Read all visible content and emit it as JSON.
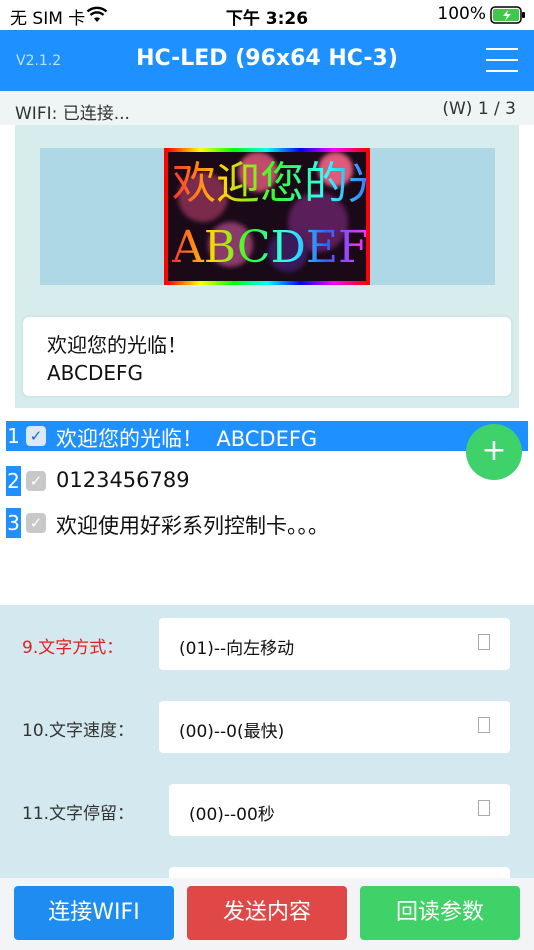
{
  "status_bar": {
    "carrier": "无 SIM 卡",
    "time": "下午 3:26",
    "battery": "100%"
  },
  "nav": {
    "version": "V2.1.2",
    "title": "HC-LED (96x64 HC-3)"
  },
  "wifi": {
    "status": "WIFI: 已连接...",
    "page": "(W) 1 / 3"
  },
  "preview": {
    "line1": "欢迎您的光临！",
    "line2": "ABCDEFG"
  },
  "text_box": {
    "content": "欢迎您的光临！\nABCDEFG"
  },
  "programs": [
    {
      "num": "1",
      "label": "欢迎您的光临！  ABCDEFG",
      "checked": true
    },
    {
      "num": "2",
      "label": "0123456789",
      "checked": true
    },
    {
      "num": "3",
      "label": "欢迎使用好彩系列控制卡。。。",
      "checked": true
    }
  ],
  "settings": [
    {
      "label": "9.文字方式：",
      "value": "(01)--向左移动",
      "highlight": true
    },
    {
      "label": "10.文字速度：",
      "value": "(00)--0(最快)",
      "highlight": false
    },
    {
      "label": "11.文字停留：",
      "value": "(00)--00秒",
      "highlight": false
    }
  ],
  "buttons": {
    "connect": "连接WIFI",
    "send": "发送内容",
    "read": "回读参数"
  },
  "colors": {
    "primary": "#1e90ff",
    "fab": "#3fd26b",
    "send": "#e04848",
    "read": "#41d169"
  }
}
